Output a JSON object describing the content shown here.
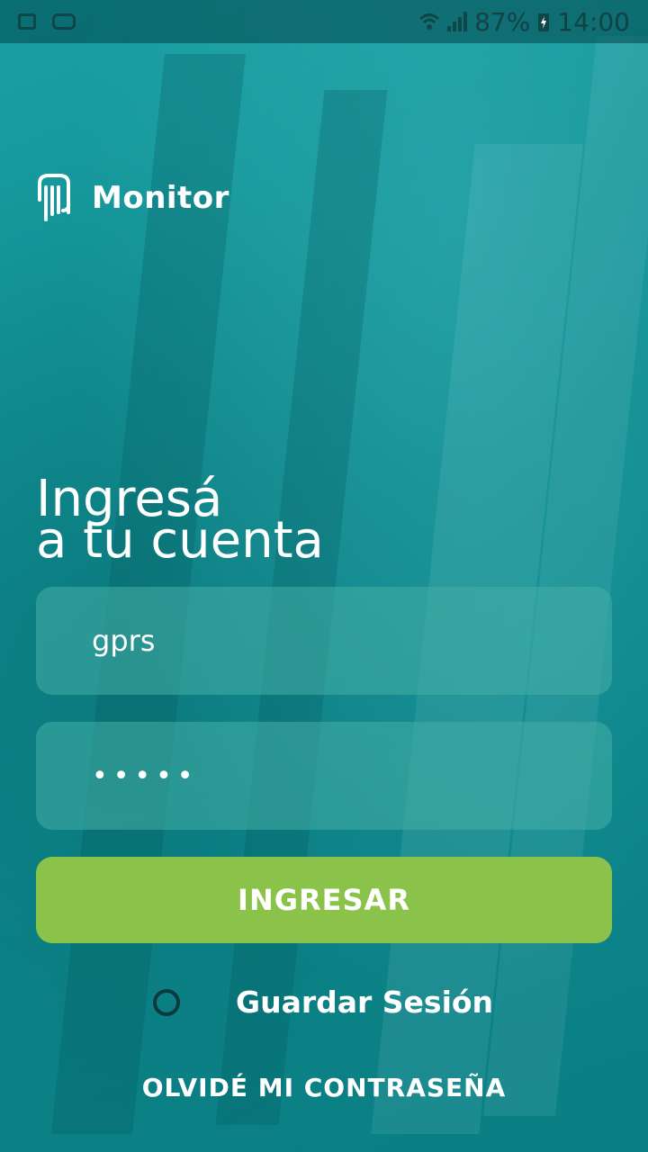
{
  "status_bar": {
    "battery": "87%",
    "time": "14:00",
    "icons": [
      "image-icon",
      "voicemail-icon",
      "wifi-icon",
      "signal-icon",
      "battery-charging-icon"
    ]
  },
  "app": {
    "name": "Monitor",
    "logo_icon": "hand-logo-icon"
  },
  "heading": {
    "line1": "Ingresá",
    "line2": "a tu cuenta"
  },
  "form": {
    "username_value": "gprs",
    "password_value": "•••••",
    "submit_label": "INGRESAR",
    "remember_label": "Guardar Sesión",
    "remember_checked": false,
    "forgot_label": "OLVIDÉ MI CONTRASEÑA"
  },
  "colors": {
    "background": "#0f8f92",
    "button": "#8bc34a",
    "text": "#ffffff"
  }
}
